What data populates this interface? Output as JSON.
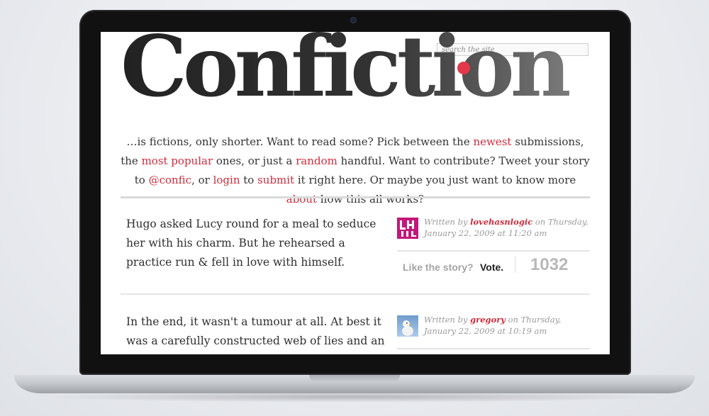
{
  "site": {
    "logo": "Confiction",
    "search_placeholder": "search the site",
    "accent": "#e3374a"
  },
  "intro": {
    "t1": "…is fictions, only shorter. Want to read some? Pick between the ",
    "newest": "newest",
    "t2": " submissions, the ",
    "most_popular": "most popular",
    "t3": " ones, or just a ",
    "random": "random",
    "t4": " handful. Want to contribute? Tweet your story to ",
    "twitter": "@confic",
    "t5": ", or ",
    "login": "login",
    "t6": " to ",
    "submit": "submit",
    "t7": " it right here. Or maybe you just want to know more ",
    "about": "about",
    "t8": " how this all works?"
  },
  "stories": [
    {
      "text": "Hugo asked Lucy round for a meal to seduce her with his charm. But he rehearsed a practice run & fell in love with himself.",
      "written_by": "Written by ",
      "author": "lovehasnlogic",
      "on": " on Thursday, January 22, 2009 at 11:20 am",
      "vote_prompt": "Like the story?",
      "vote_label": "Vote.",
      "votes": "1032"
    },
    {
      "text": "In the end, it wasn't a tumour at all. At best it was a carefully constructed web of lies and an ex-",
      "written_by": "Written by ",
      "author": "gregory",
      "on": " on Thursday, January 22, 2009 at 10:19 am"
    }
  ]
}
